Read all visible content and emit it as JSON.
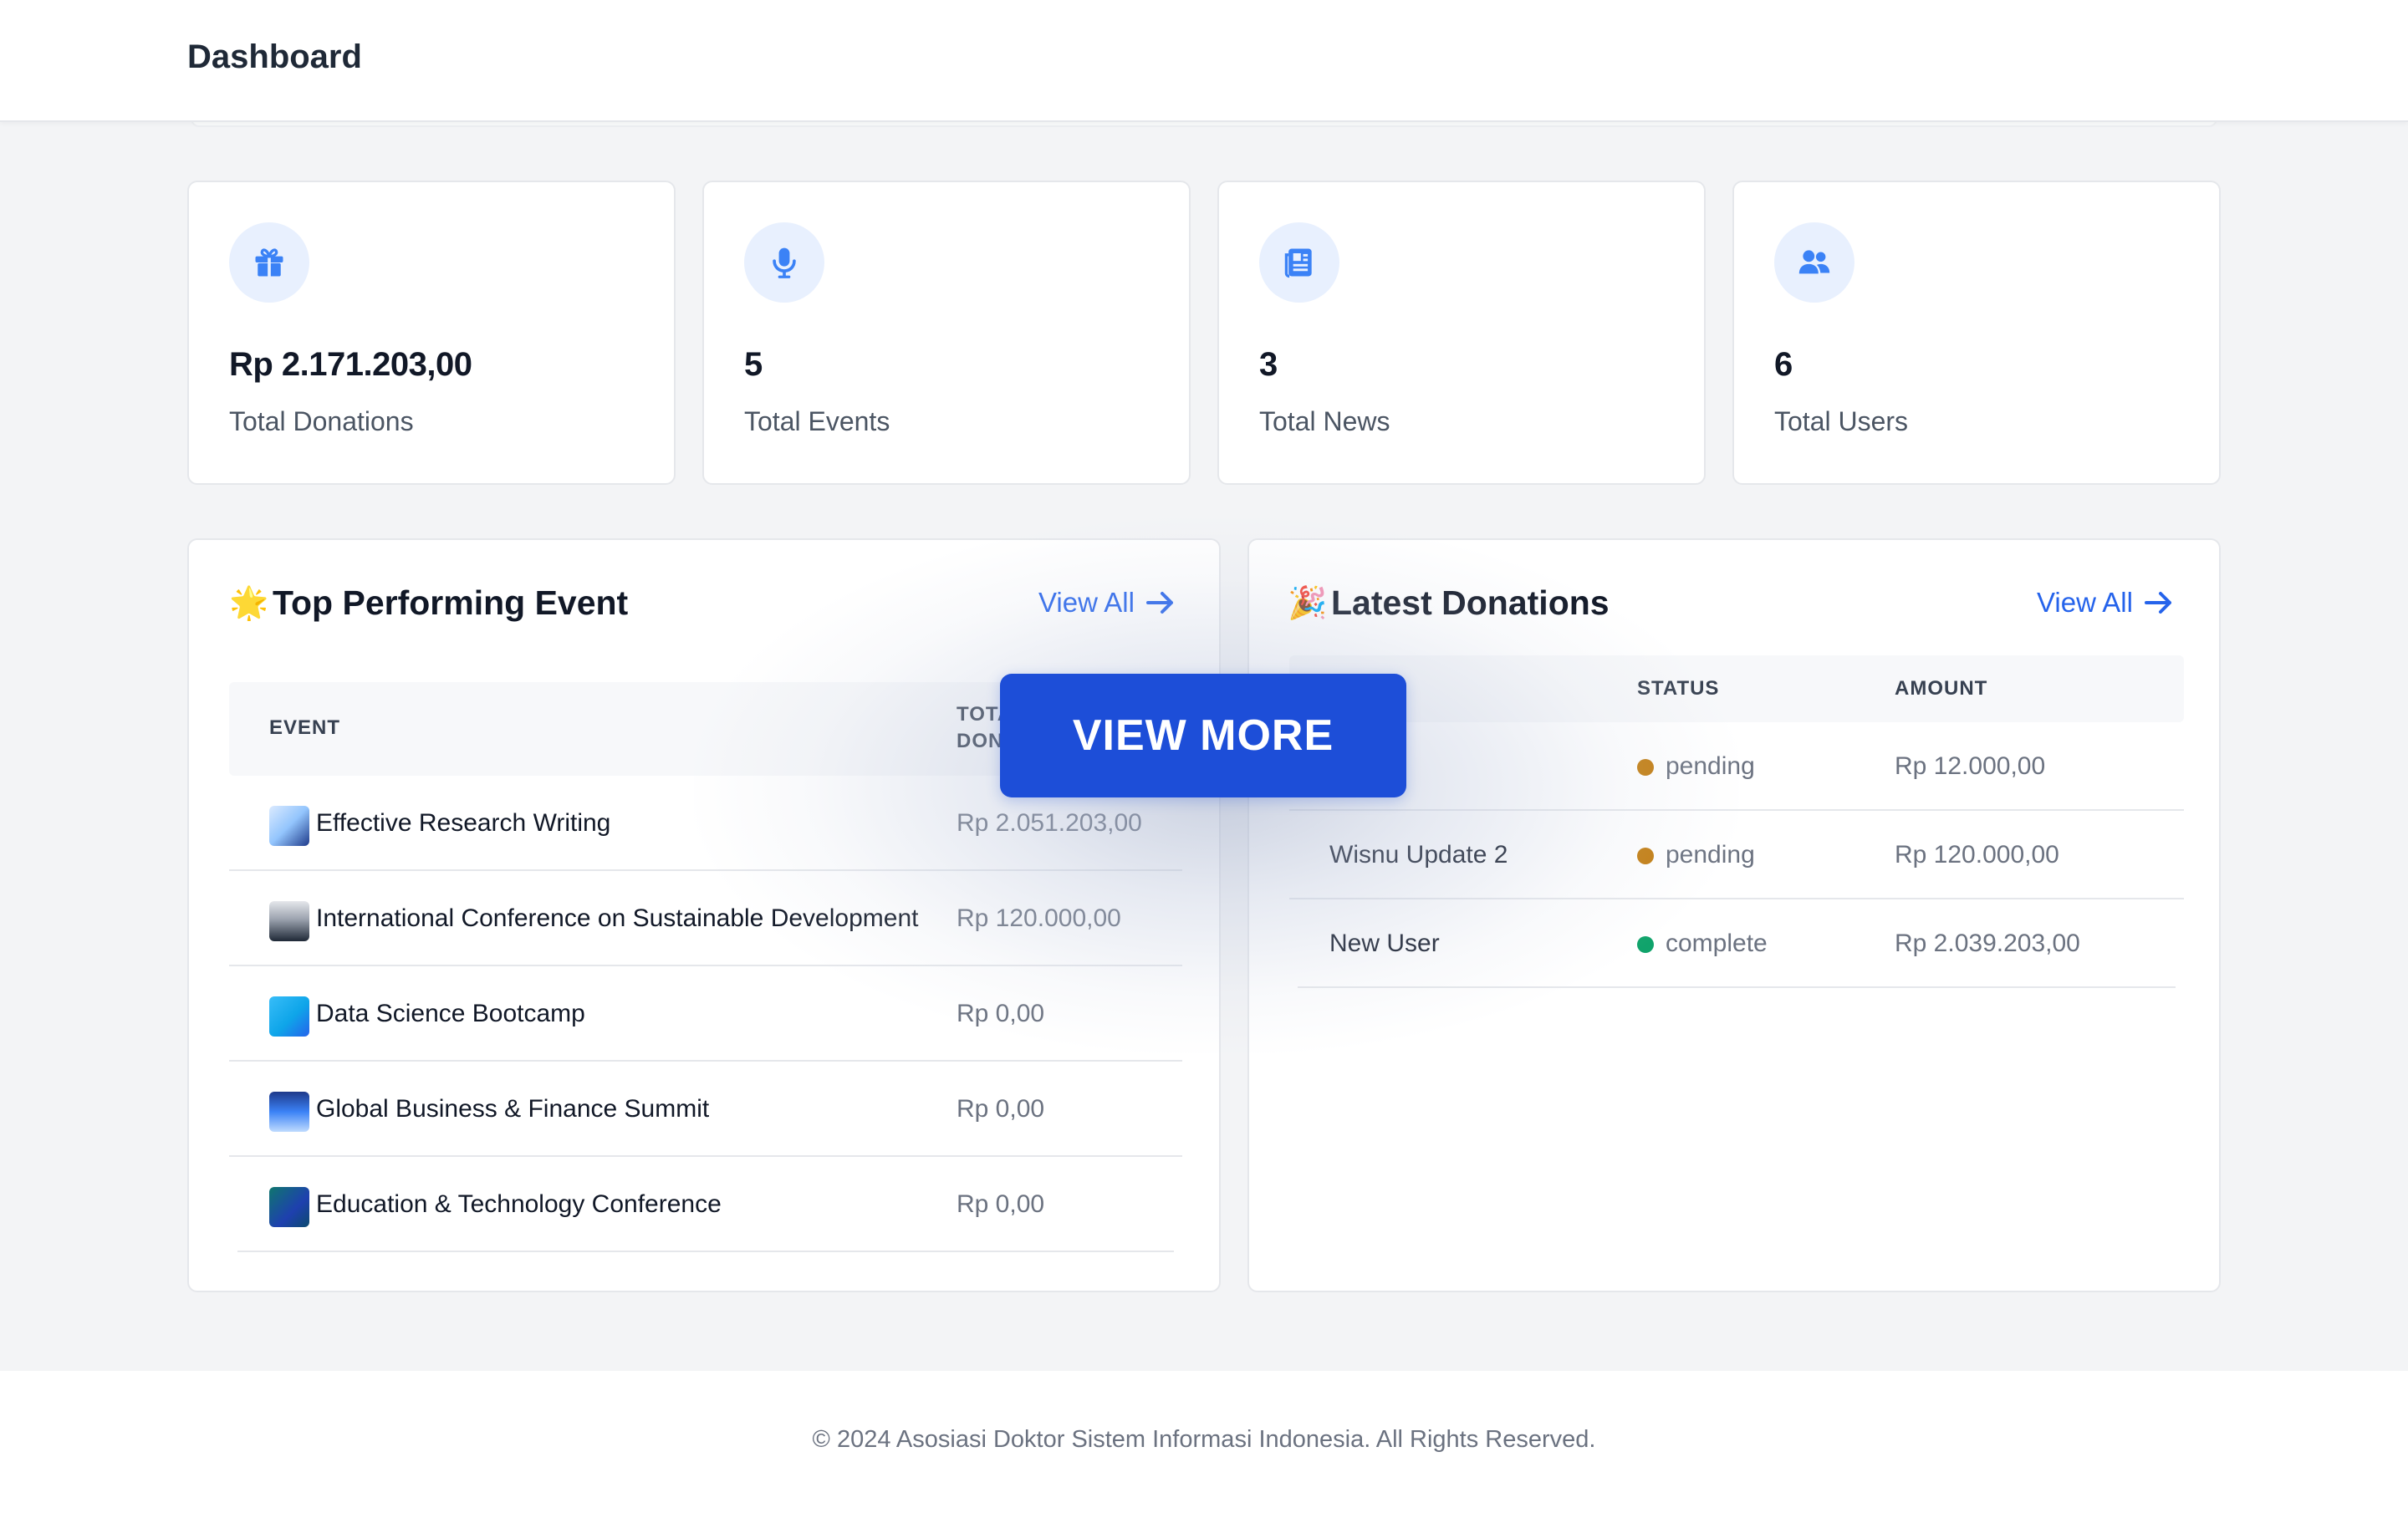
{
  "header": {
    "title": "Dashboard"
  },
  "stats": [
    {
      "icon": "gift-icon",
      "value": "Rp 2.171.203,00",
      "label": "Total Donations"
    },
    {
      "icon": "microphone-icon",
      "value": "5",
      "label": "Total Events"
    },
    {
      "icon": "newspaper-icon",
      "value": "3",
      "label": "Total News"
    },
    {
      "icon": "users-icon",
      "value": "6",
      "label": "Total Users"
    }
  ],
  "top_events": {
    "emoji": "🌟",
    "title": "Top Performing Event",
    "view_all": "View All",
    "columns": [
      "EVENT",
      "TOTAL",
      "DONATIONS"
    ],
    "rows": [
      {
        "name": "Effective Research Writing",
        "total": "Rp 2.051.203,00"
      },
      {
        "name": "International Conference on Sustainable Development",
        "total": "Rp 120.000,00"
      },
      {
        "name": "Data Science Bootcamp",
        "total": "Rp 0,00"
      },
      {
        "name": "Global Business & Finance Summit",
        "total": "Rp 0,00"
      },
      {
        "name": "Education & Technology Conference",
        "total": "Rp 0,00"
      }
    ]
  },
  "latest_donations": {
    "emoji": "🎉",
    "title": "Latest Donations",
    "view_all": "View All",
    "columns": [
      "STATUS",
      "AMOUNT"
    ],
    "rows": [
      {
        "name": "",
        "status": "pending",
        "amount": "Rp 12.000,00"
      },
      {
        "name": "Wisnu Update 2",
        "status": "pending",
        "amount": "Rp 120.000,00"
      },
      {
        "name": "New User",
        "status": "complete",
        "amount": "Rp 2.039.203,00"
      }
    ]
  },
  "status_colors": {
    "pending": "#c27c0e",
    "complete": "#10a36b"
  },
  "overlay": {
    "button_label": "VIEW MORE"
  },
  "footer": {
    "copyright": "© 2024 Asosiasi Doktor Sistem Informasi Indonesia. All Rights Reserved."
  }
}
